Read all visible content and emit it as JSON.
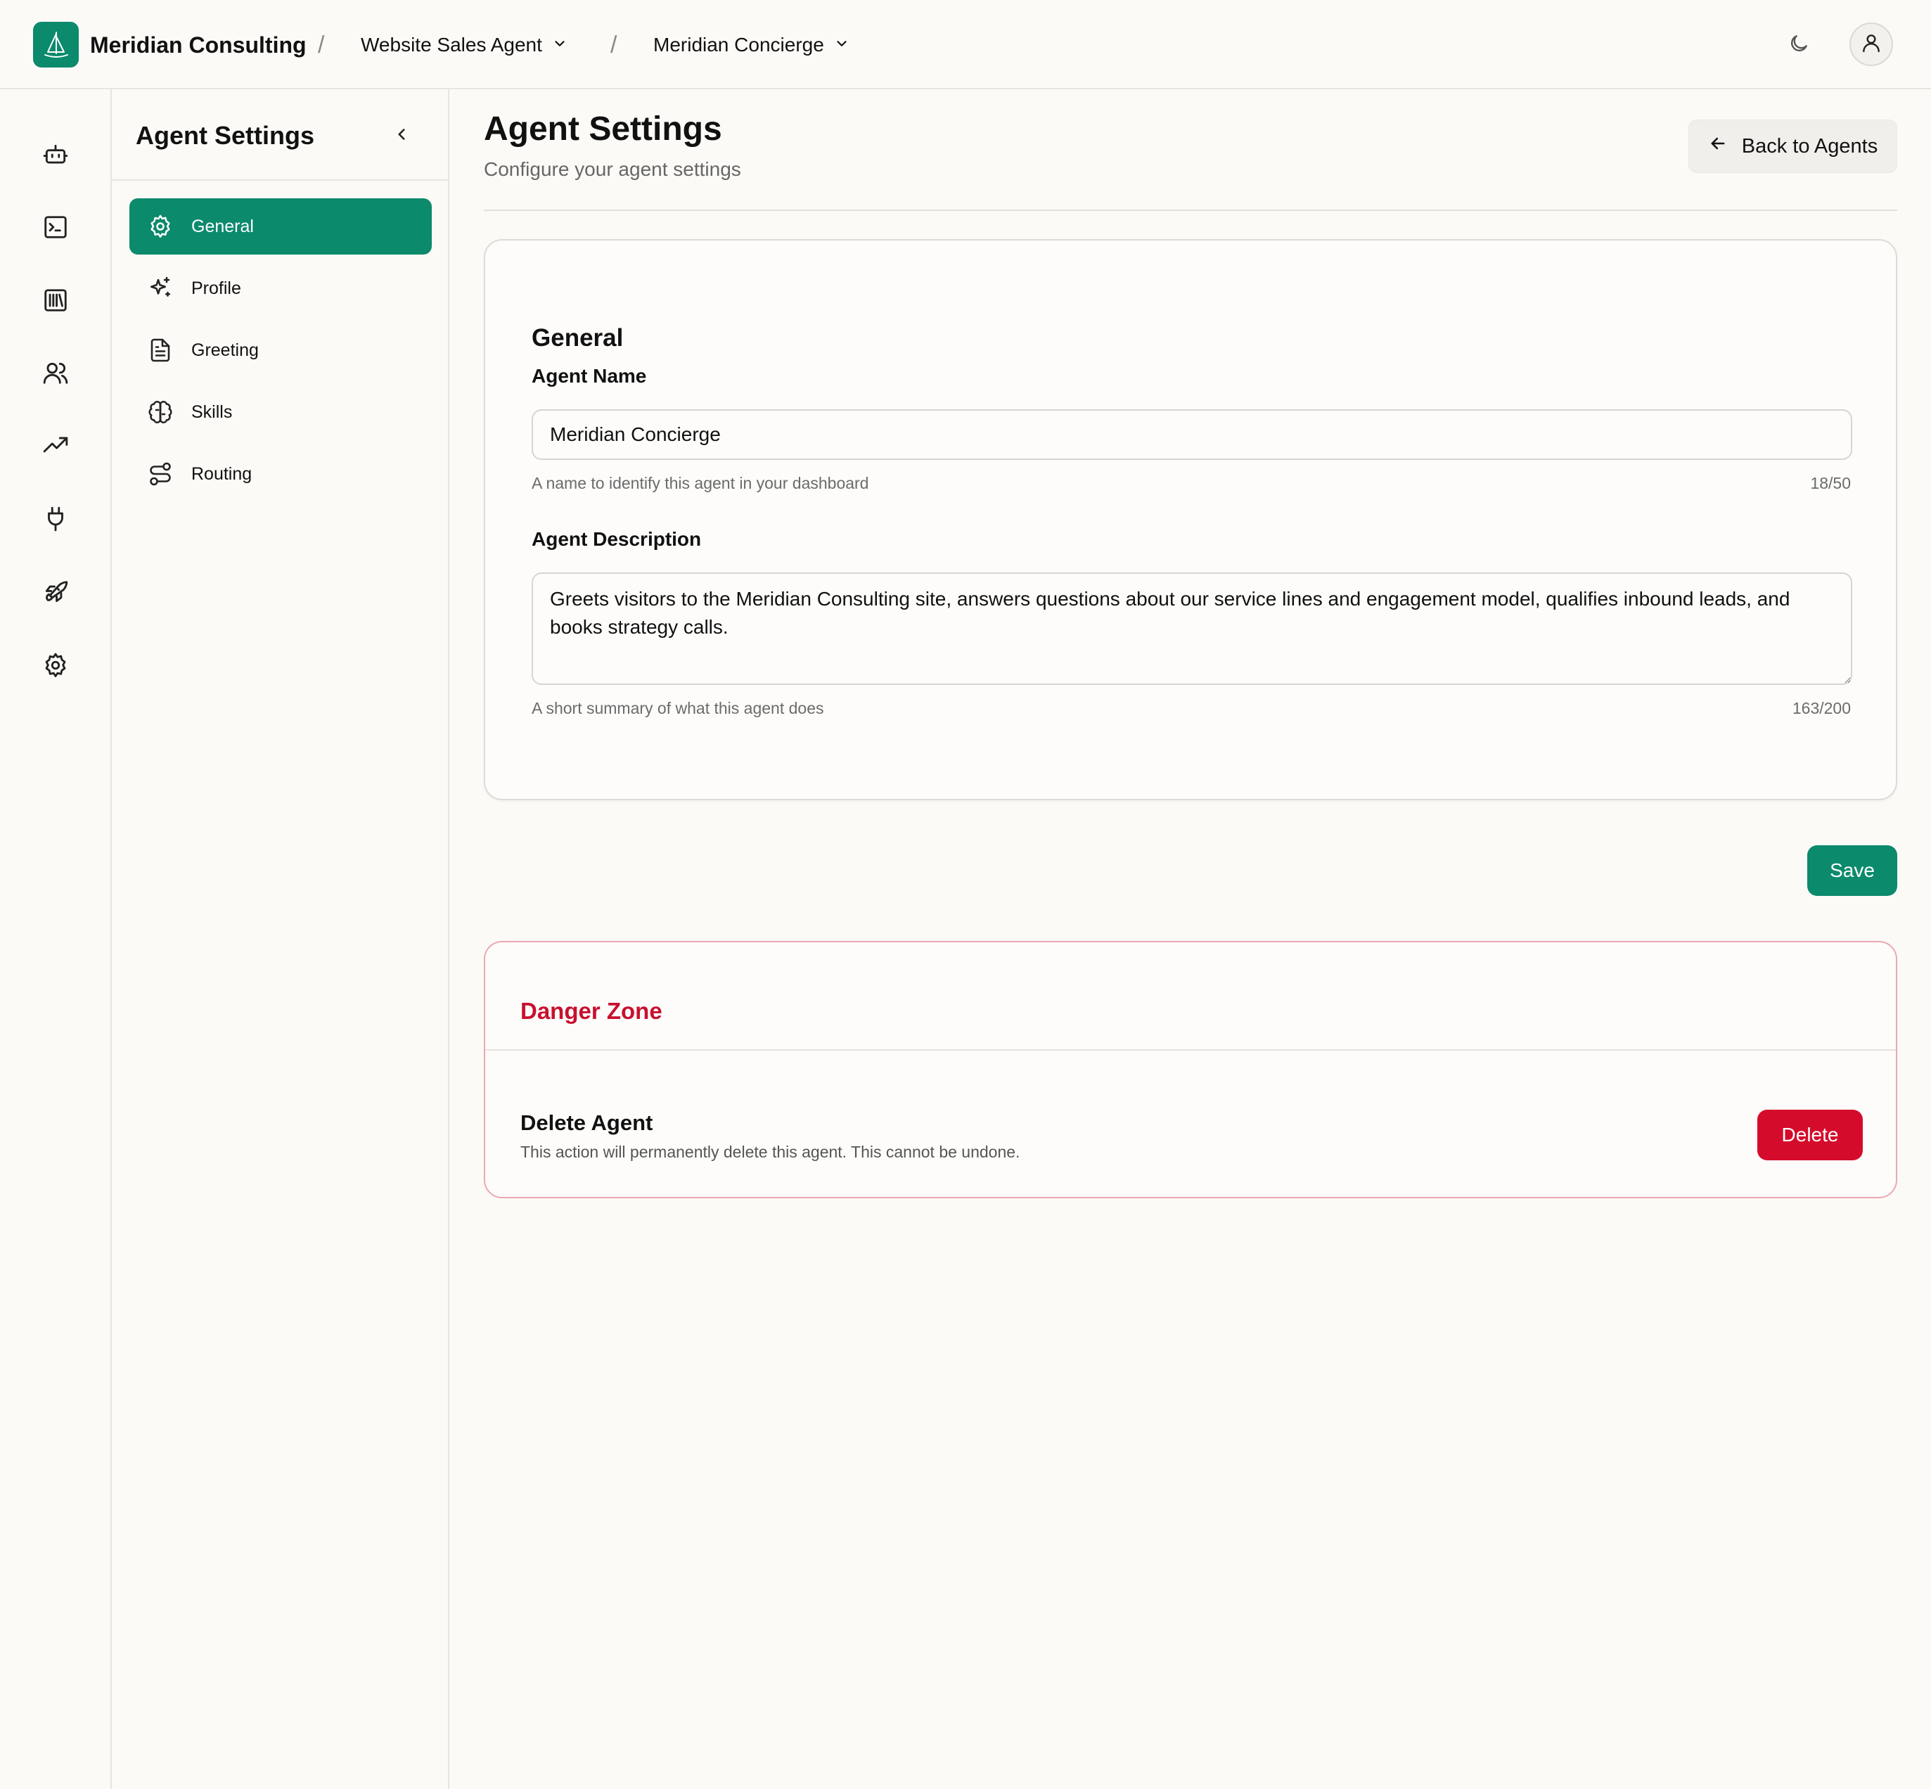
{
  "header": {
    "org_name": "Meridian Consulting",
    "separator": "/",
    "breadcrumbs": [
      {
        "label": "Website Sales Agent",
        "icon": "chevron-down-icon"
      },
      {
        "label": "Meridian Concierge",
        "icon": "chevron-down-icon"
      }
    ],
    "theme_toggle_icon": "moon-icon",
    "account_icon": "user-icon"
  },
  "rail": {
    "items": [
      {
        "name": "bot",
        "icon": "bot-icon"
      },
      {
        "name": "terminal",
        "icon": "terminal-icon"
      },
      {
        "name": "library",
        "icon": "library-icon"
      },
      {
        "name": "users",
        "icon": "users-icon"
      },
      {
        "name": "analytics",
        "icon": "trending-up-icon"
      },
      {
        "name": "integrations",
        "icon": "plug-icon"
      },
      {
        "name": "deploy",
        "icon": "rocket-icon"
      },
      {
        "name": "settings",
        "icon": "gear-icon"
      }
    ]
  },
  "sidebar": {
    "title": "Agent Settings",
    "collapse_icon": "chevron-left-icon",
    "items": [
      {
        "label": "General",
        "icon": "gear-icon",
        "active": true
      },
      {
        "label": "Profile",
        "icon": "sparkles-icon",
        "active": false
      },
      {
        "label": "Greeting",
        "icon": "document-icon",
        "active": false
      },
      {
        "label": "Skills",
        "icon": "brain-icon",
        "active": false
      },
      {
        "label": "Routing",
        "icon": "route-icon",
        "active": false
      }
    ]
  },
  "main": {
    "title": "Agent Settings",
    "subtitle": "Configure your agent settings",
    "back_button": "Back to Agents",
    "general": {
      "title": "General",
      "name_label": "Agent Name",
      "name_value": "Meridian Concierge",
      "name_help": "A name to identify this agent in your dashboard",
      "name_counter": "18/50",
      "description_label": "Agent Description",
      "description_value": "Greets visitors to the Meridian Consulting site, answers questions about our service lines and engagement model, qualifies inbound leads, and books strategy calls.",
      "description_help": "A short summary of what this agent does",
      "description_counter": "163/200"
    },
    "save_button": "Save",
    "danger": {
      "title": "Danger Zone",
      "delete_title": "Delete Agent",
      "delete_description": "This action will permanently delete this agent. This cannot be undone.",
      "delete_button": "Delete"
    }
  },
  "colors": {
    "accent": "#0b8a6c",
    "danger": "#d50b2b",
    "danger_text": "#c8102e",
    "background": "#fcfaf7"
  }
}
